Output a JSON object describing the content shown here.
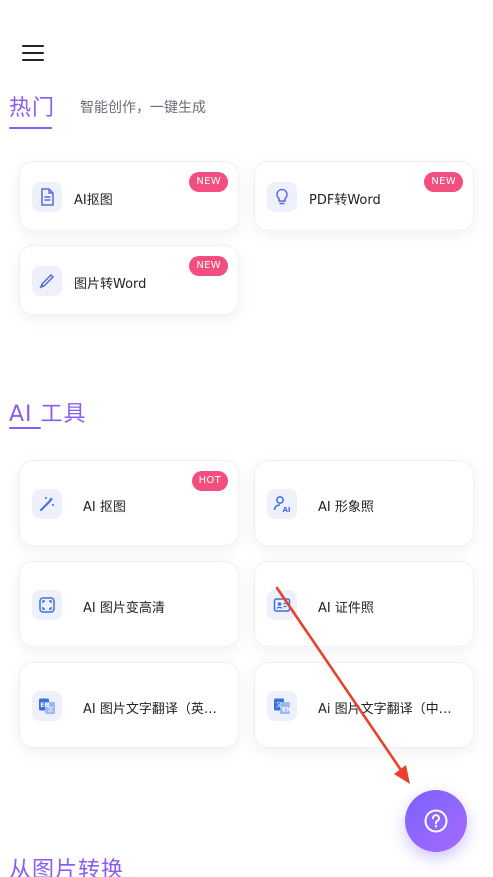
{
  "header": {
    "menu_icon": "hamburger-menu-icon"
  },
  "hot": {
    "title": "热门",
    "subtitle": "智能创作，一键生成",
    "cards": [
      {
        "label": "AI抠图",
        "badge": "NEW",
        "icon": "document-icon"
      },
      {
        "label": "PDF转Word",
        "badge": "NEW",
        "icon": "lightbulb-icon"
      },
      {
        "label": "图片转Word",
        "badge": "NEW",
        "icon": "pen-icon"
      }
    ]
  },
  "ai_tools": {
    "title": "AI 工具",
    "cards": [
      {
        "label": "AI 抠图",
        "badge": "HOT",
        "icon": "magic-wand-icon"
      },
      {
        "label": "AI 形象照",
        "icon": "ai-portrait-icon"
      },
      {
        "label": "AI 图片变高清",
        "icon": "enhance-frame-icon"
      },
      {
        "label": "AI 证件照",
        "icon": "id-photo-icon"
      },
      {
        "label": "AI 图片文字翻译（英…",
        "icon": "translate-en-icon"
      },
      {
        "label": "Ai 图片文字翻译（中…",
        "icon": "translate-zh-icon"
      }
    ]
  },
  "from_image": {
    "title": "从图片转换"
  },
  "help": {
    "icon": "help-question-icon"
  },
  "colors": {
    "accent": "#8a5cf6",
    "badge": "#f24e7f",
    "fab": "#7b61ff",
    "arrow": "#e8412c"
  }
}
